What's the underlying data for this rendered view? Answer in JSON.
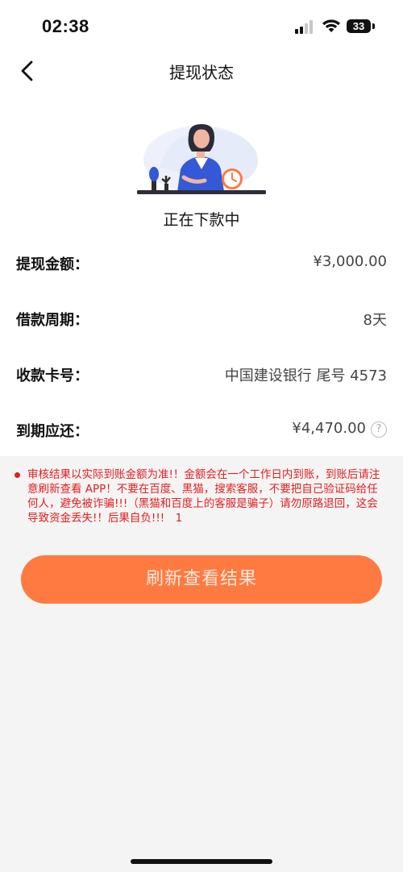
{
  "status_bar": {
    "time": "02:38",
    "battery": "33"
  },
  "nav": {
    "title": "提现状态",
    "back_icon": "chevron-left-icon"
  },
  "illustration": {
    "name": "woman-at-desk-with-clock-illustration",
    "accent_color": "#ff7a41",
    "primary_color": "#3459d6"
  },
  "status": {
    "text": "正在下款中"
  },
  "info": [
    {
      "label": "提现金额：",
      "value": "¥3,000.00"
    },
    {
      "label": "借款周期：",
      "value": "8天"
    },
    {
      "label": "收款卡号：",
      "value": "中国建设银行 尾号 4573"
    },
    {
      "label": "到期应还：",
      "value": "¥4,470.00",
      "help_icon": "question-circle-icon"
    }
  ],
  "notice": {
    "text": "审核结果以实际到账金额为准!！金额会在一个工作日内到账，到账后请注意刷新查看 APP！不要在百度、黑猫，搜索客服，不要把自己验证码给任何人，避免被诈骗!!!（黑猫和百度上的客服是骗子）请勿原路退回，这会导致资金丢失!！后果自负!!!　1",
    "color": "#e02020"
  },
  "button": {
    "label": "刷新查看结果",
    "color": "#ff7a41"
  }
}
